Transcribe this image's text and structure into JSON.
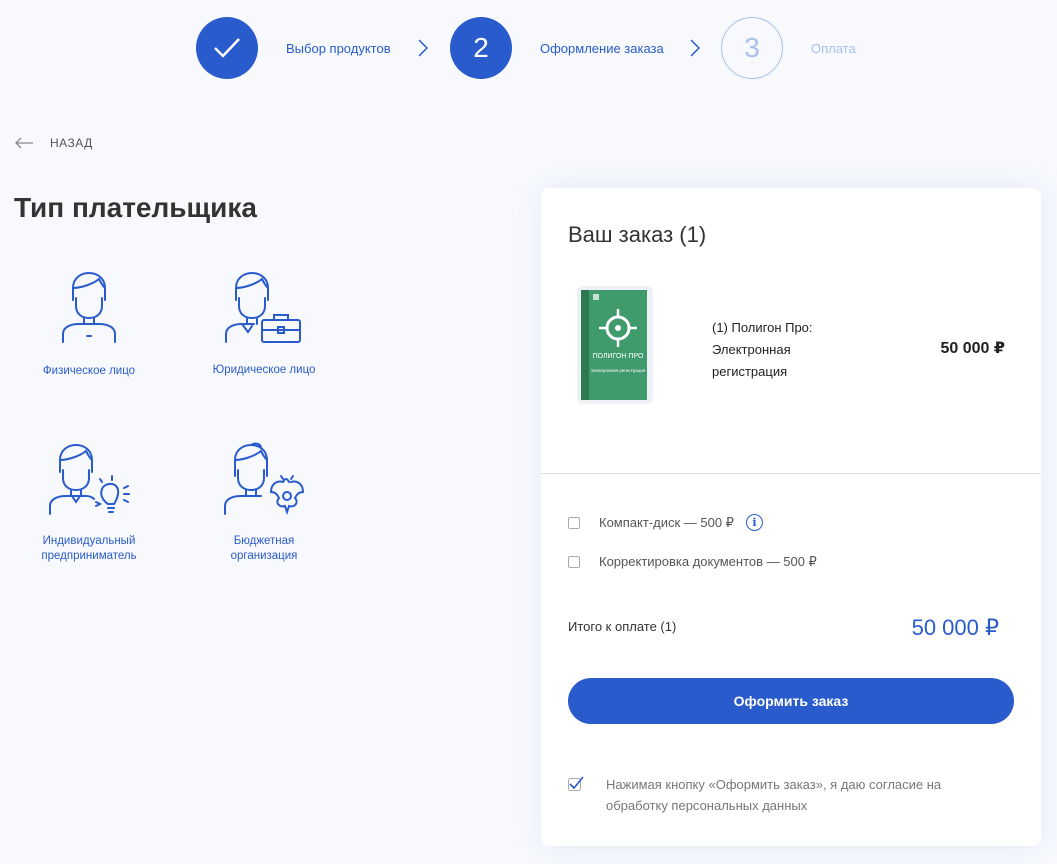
{
  "stepper": {
    "steps": [
      {
        "label": "Выбор продуктов",
        "state": "done",
        "number": ""
      },
      {
        "label": "Оформление заказа",
        "state": "active",
        "number": "2"
      },
      {
        "label": "Оплата",
        "state": "pending",
        "number": "3"
      }
    ]
  },
  "back": {
    "label": "НАЗАД"
  },
  "payer": {
    "title": "Тип плательщика",
    "types": [
      {
        "label": "Физическое лицо",
        "icon": "person-icon"
      },
      {
        "label": "Юридическое лицо",
        "icon": "person-briefcase-icon"
      },
      {
        "label": "Индивидуальный предприниматель",
        "icon": "person-lightbulb-icon"
      },
      {
        "label": "Бюджетная организация",
        "icon": "person-emblem-icon"
      }
    ]
  },
  "order": {
    "title": "Ваш заказ (1)",
    "product": {
      "name": "(1) Полигон Про: Электронная регистрация",
      "price": "50 000 ₽",
      "box_text": "ПОЛИГОН ПРО",
      "box_subtext": "Электронная регистрация"
    },
    "options": [
      {
        "label": "Компакт-диск — 500 ₽",
        "checked": false,
        "has_info": true
      },
      {
        "label": "Корректировка документов — 500 ₽",
        "checked": false,
        "has_info": false
      }
    ],
    "total_label": "Итого к оплате (1)",
    "total_value": "50 000 ₽",
    "submit_label": "Оформить заказ",
    "consent": {
      "checked": true,
      "text": "Нажимая кнопку «Оформить заказ», я даю согласие на обработку персональных данных"
    }
  },
  "colors": {
    "accent": "#2a5bcc",
    "pending": "#a9c0ea",
    "background": "#f7f9fd",
    "box_green": "#3f9b6c"
  }
}
